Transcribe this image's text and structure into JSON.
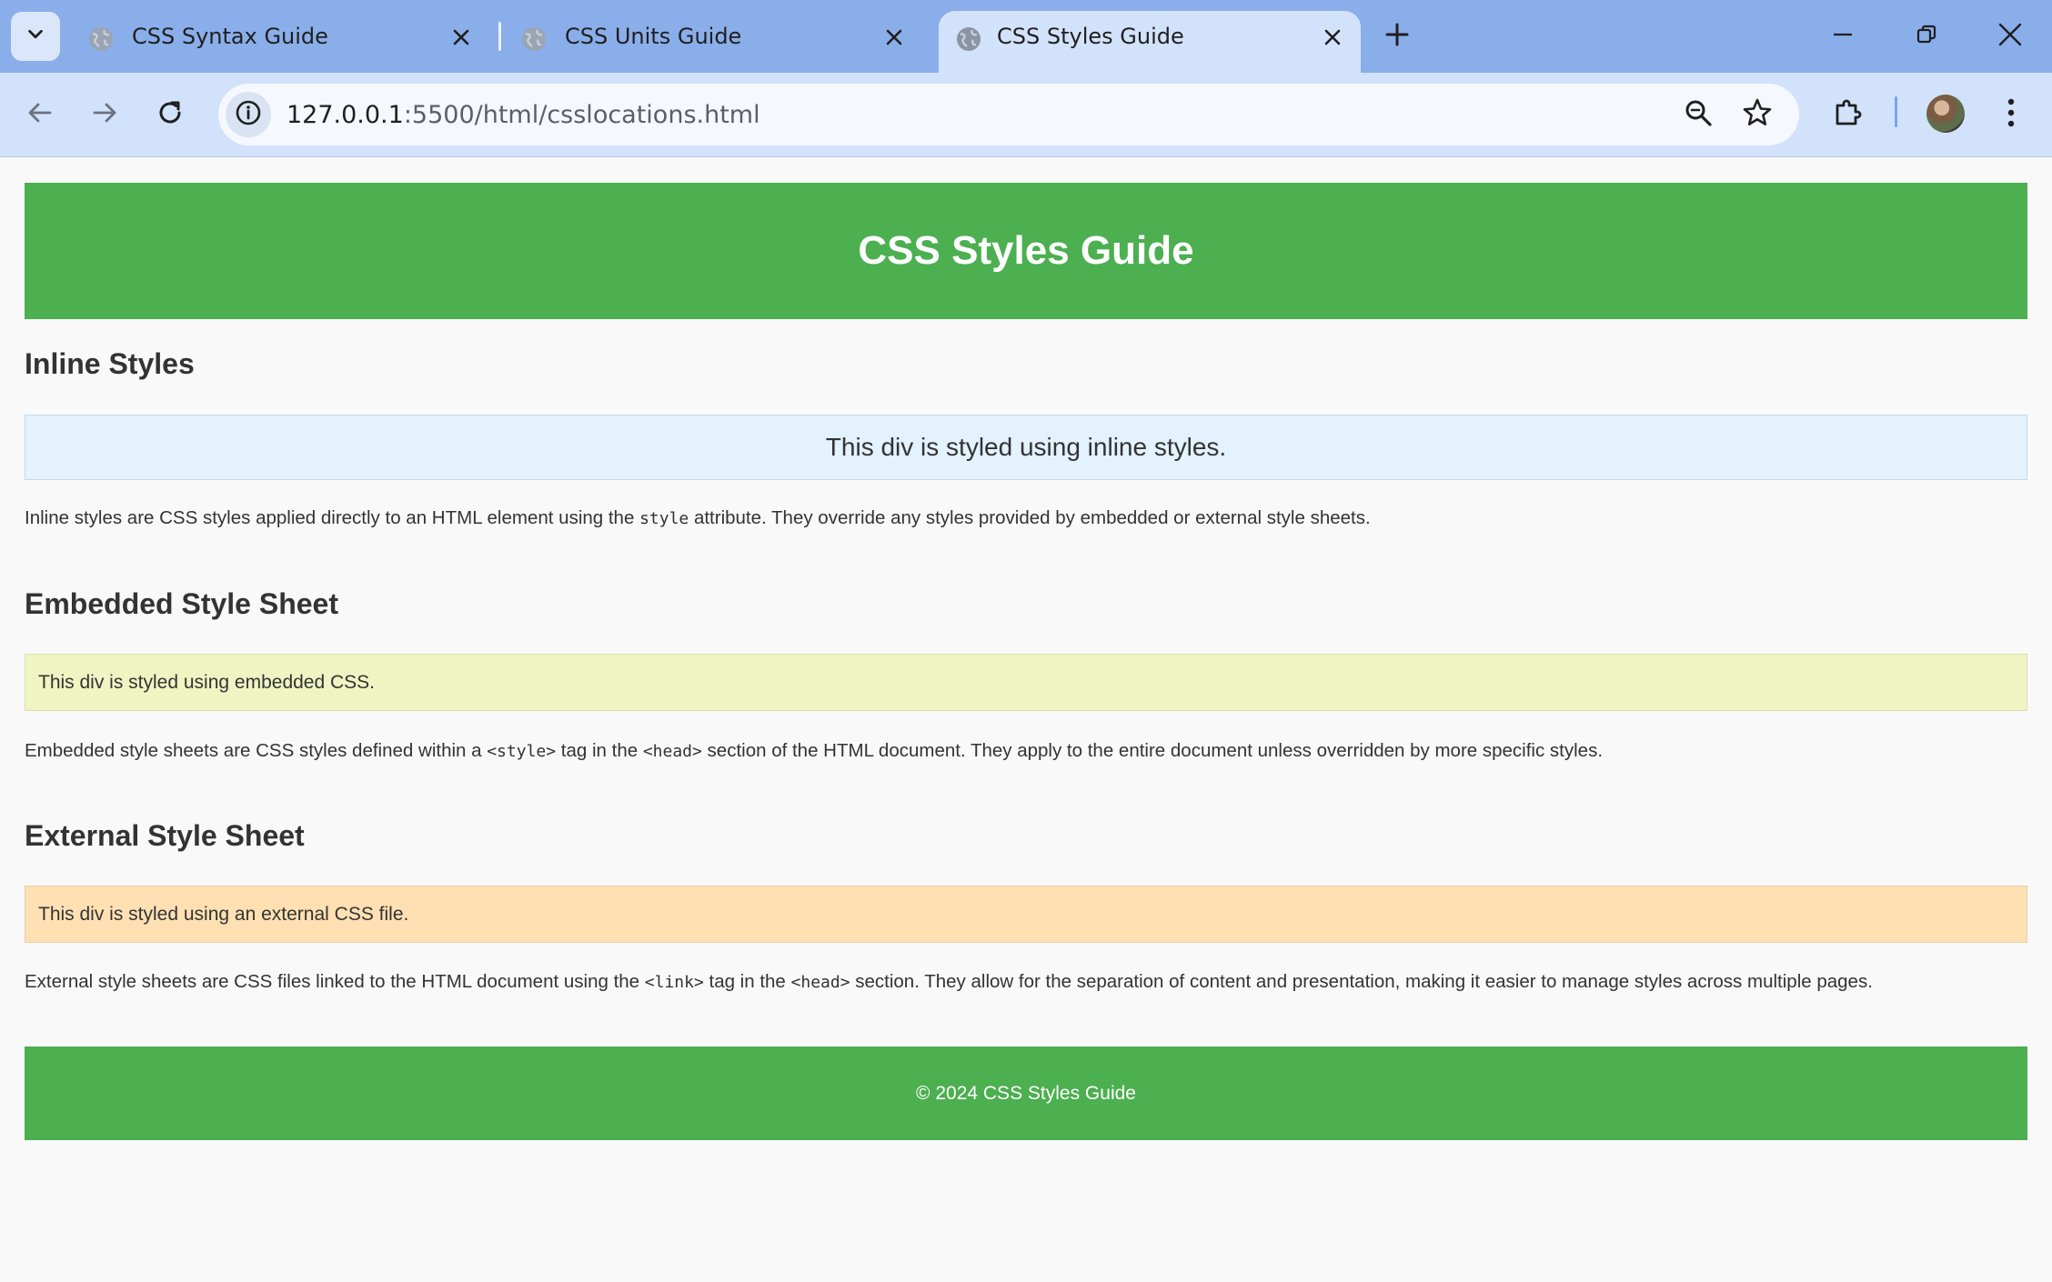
{
  "browser": {
    "tabs": [
      {
        "title": "CSS Syntax Guide",
        "active": false
      },
      {
        "title": "CSS Units Guide",
        "active": false
      },
      {
        "title": "CSS Styles Guide",
        "active": true
      }
    ],
    "url_host": "127.0.0.1",
    "url_path": ":5500/html/csslocations.html",
    "icons": {
      "tab_search": "chevron-down-icon",
      "favicon": "globe-icon",
      "close": "close-icon",
      "new_tab": "plus-icon",
      "back": "arrow-left-icon",
      "forward": "arrow-right-icon",
      "reload": "reload-icon",
      "site_info": "info-icon",
      "zoom": "zoom-icon",
      "bookmark": "star-icon",
      "extensions": "puzzle-icon",
      "profile": "avatar",
      "menu": "kebab-menu-icon"
    },
    "colors": {
      "tab_strip": "#8aaeea",
      "toolbar": "#d3e2fb"
    }
  },
  "page": {
    "header_title": "CSS Styles Guide",
    "sections": {
      "inline": {
        "heading": "Inline Styles",
        "demo_text": "This div is styled using inline styles.",
        "desc_before": "Inline styles are CSS styles applied directly to an HTML element using the ",
        "desc_code": "style",
        "desc_after": " attribute. They override any styles provided by embedded or external style sheets."
      },
      "embedded": {
        "heading": "Embedded Style Sheet",
        "demo_text": "This div is styled using embedded CSS.",
        "desc_1": "Embedded style sheets are CSS styles defined within a ",
        "desc_code_1": "<style>",
        "desc_2": " tag in the ",
        "desc_code_2": "<head>",
        "desc_3": " section of the HTML document. They apply to the entire document unless overridden by more specific styles."
      },
      "external": {
        "heading": "External Style Sheet",
        "demo_text": "This div is styled using an external CSS file.",
        "desc_1": "External style sheets are CSS files linked to the HTML document using the ",
        "desc_code_1": "<link>",
        "desc_2": " tag in the ",
        "desc_code_2": "<head>",
        "desc_3": " section. They allow for the separation of content and presentation, making it easier to manage styles across multiple pages."
      }
    },
    "footer_text": "© 2024 CSS Styles Guide",
    "colors": {
      "header_green": "#4caf50",
      "inline_bg": "#e3f2fd",
      "embedded_bg": "#f0f4c3",
      "external_bg": "#ffe0b2"
    }
  }
}
